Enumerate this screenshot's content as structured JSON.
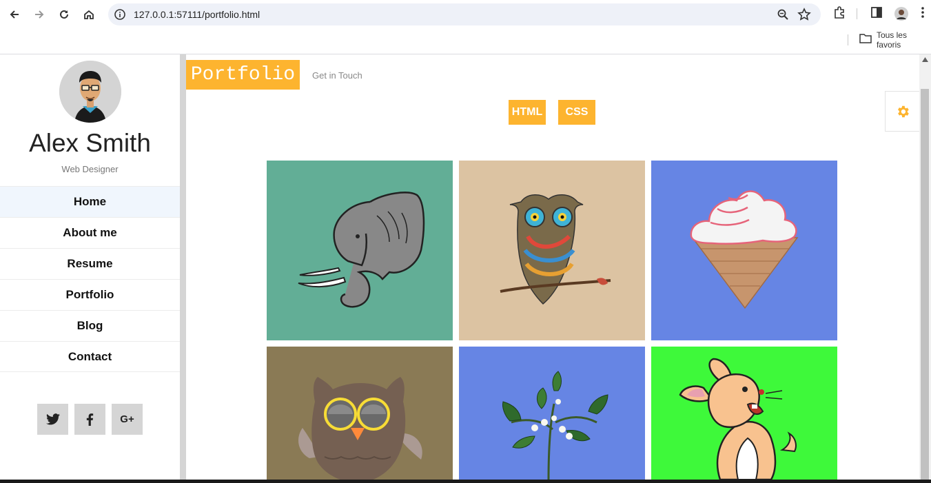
{
  "browser": {
    "url": "127.0.0.1:57111/portfolio.html",
    "bookmarks_label": "Tous les favoris"
  },
  "profile": {
    "name": "Alex Smith",
    "role": "Web Designer"
  },
  "menu": [
    {
      "label": "Home",
      "active": true
    },
    {
      "label": "About me"
    },
    {
      "label": "Resume"
    },
    {
      "label": "Portfolio"
    },
    {
      "label": "Blog"
    },
    {
      "label": "Contact"
    }
  ],
  "social": [
    {
      "icon": "twitter-icon",
      "glyph": "𝕥"
    },
    {
      "icon": "facebook-icon",
      "glyph": "f"
    },
    {
      "icon": "google-plus-icon",
      "glyph": "G+"
    }
  ],
  "header": {
    "brand": "Portfolio",
    "get_in_touch": "Get in Touch"
  },
  "filters": [
    "HTML",
    "CSS"
  ],
  "portfolio": [
    {
      "subject": "elephant",
      "bg": "#62ae96"
    },
    {
      "subject": "owl-sketch",
      "bg": "#dcc3a2"
    },
    {
      "subject": "ice-cream",
      "bg": "#6685e4"
    },
    {
      "subject": "owl-cartoon",
      "bg": "#8a7a55"
    },
    {
      "subject": "flower-branch",
      "bg": "#6685e4"
    },
    {
      "subject": "rabbit",
      "bg": "#3ef93a"
    }
  ],
  "colors": {
    "accent": "#fdb42f"
  }
}
